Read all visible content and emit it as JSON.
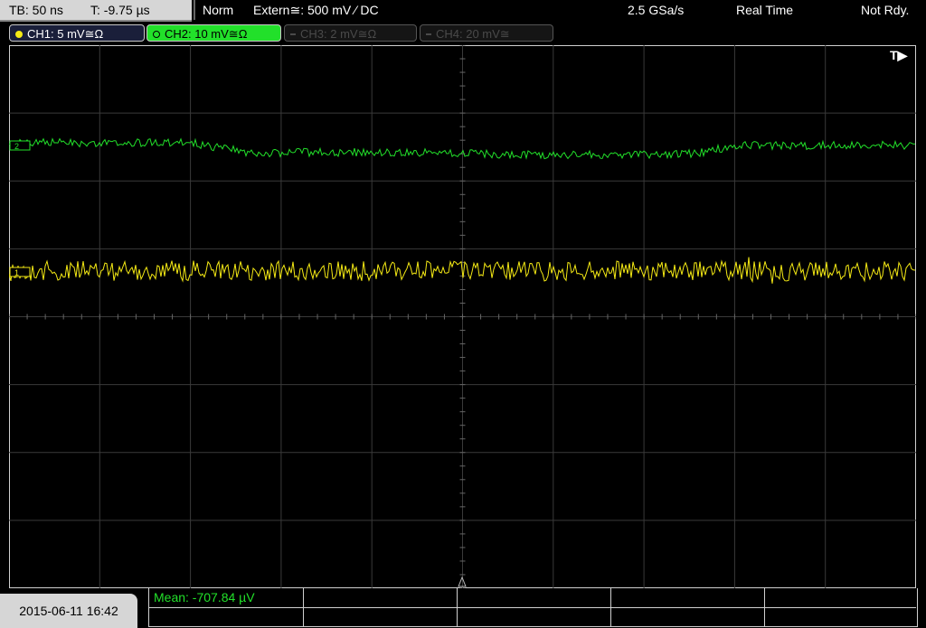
{
  "topbar": {
    "timebase": "TB: 50 ns",
    "trigger_time": "T: -9.75 µs",
    "trigger_mode": "Norm",
    "trigger_source": "Extern≅: 500 mV ⁄ DC",
    "sample_rate": "2.5 GSa/s",
    "acq_mode": "Real Time",
    "status": "Not Rdy."
  },
  "channels": [
    {
      "label": "CH1: 5 mV≅Ω",
      "color": "#f5ea14",
      "active": true
    },
    {
      "label": "CH2: 10 mV≅Ω",
      "color": "#22e02a",
      "active": true,
      "selected": true
    },
    {
      "label": "CH3: 2 mV≅Ω",
      "color": "#4a4a4a",
      "active": false
    },
    {
      "label": "CH4: 20 mV≅",
      "color": "#4a4a4a",
      "active": false
    }
  ],
  "screen": {
    "trigger_marker": "T▶",
    "ch1_marker": "1",
    "ch2_marker": "2"
  },
  "bottombar": {
    "datetime": "2015-06-11 16:42",
    "measurement": "Mean: -707.84 µV"
  },
  "colors": {
    "ch1": "#f5ea14",
    "ch2": "#22e02a",
    "grid": "#3a3a3a"
  }
}
